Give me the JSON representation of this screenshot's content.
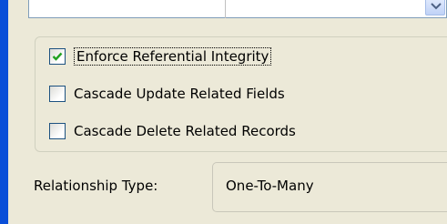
{
  "options": {
    "enforce_integrity": {
      "label": "Enforce Referential Integrity",
      "checked": true
    },
    "cascade_update": {
      "label": "Cascade Update Related Fields",
      "checked": false
    },
    "cascade_delete": {
      "label": "Cascade Delete Related Records",
      "checked": false
    }
  },
  "relationship": {
    "label": "Relationship Type:",
    "value": "One-To-Many"
  },
  "colors": {
    "accent_bar": "#0a4fd8",
    "dialog_bg": "#ece9d8",
    "checkmark": "#21a121"
  },
  "icons": {
    "dropdown": "chevron-down-icon",
    "check": "checkmark-icon"
  }
}
